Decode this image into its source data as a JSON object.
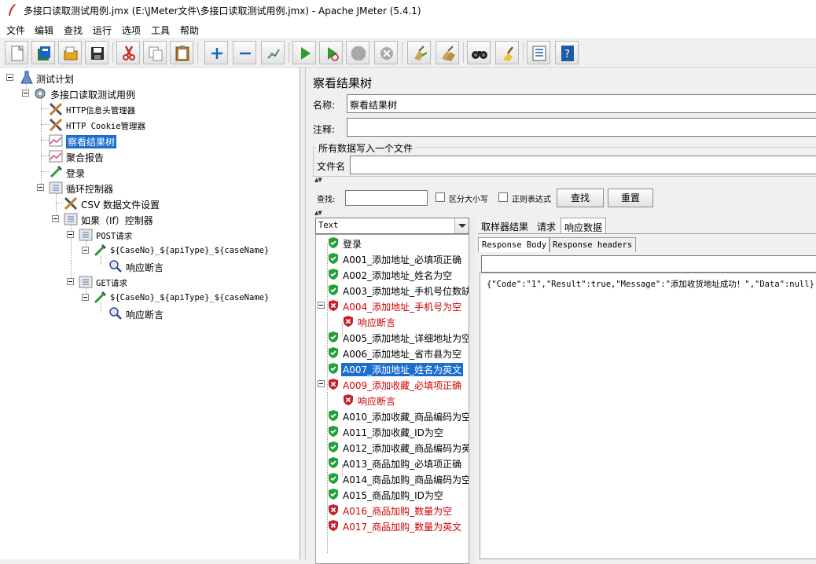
{
  "window": {
    "title": "多接口读取测试用例.jmx (E:\\JMeter文件\\多接口读取测试用例.jmx) - Apache JMeter (5.4.1)"
  },
  "menu": [
    "文件",
    "编辑",
    "查找",
    "运行",
    "选项",
    "工具",
    "帮助"
  ],
  "toolbar": {
    "icons": [
      "new-icon",
      "templates-icon",
      "open-icon",
      "save-icon",
      "cut-icon",
      "copy-icon",
      "paste-icon",
      "expand-icon",
      "collapse-icon",
      "toggle-icon",
      "start-icon",
      "start-no-pause-icon",
      "stop-icon",
      "shutdown-icon",
      "clear-icon",
      "clear-all-icon",
      "search-icon",
      "reset-search-icon",
      "function-helper-icon",
      "help-icon"
    ]
  },
  "tree": {
    "test_plan": "测试计划",
    "thread_group": "多接口读取测试用例",
    "header_manager": "HTTP信息头管理器",
    "cookie_manager": "HTTP Cookie管理器",
    "result_tree": "察看结果树",
    "aggregate_report": "聚合报告",
    "login": "登录",
    "loop_controller": "循环控制器",
    "csv_config": "CSV 数据文件设置",
    "if_controller": "如果（If）控制器",
    "post_controller": "POST请求",
    "post_sampler": "${CaseNo}_${apiType}_${caseName}",
    "post_assertion": "响应断言",
    "get_controller": "GET请求",
    "get_sampler": "${CaseNo}_${apiType}_${caseName}",
    "get_assertion": "响应断言"
  },
  "panel": {
    "title": "察看结果树",
    "name_label": "名称:",
    "name_value": "察看结果树",
    "comment_label": "注释:",
    "comment_value": "",
    "file_group_title": "所有数据写入一个文件",
    "filename_label": "文件名",
    "filename_value": ""
  },
  "search": {
    "label": "查找:",
    "value": "",
    "case_sensitive": "区分大小写",
    "regex": "正则表达式",
    "search_button": "查找",
    "reset_button": "重置"
  },
  "renderer": {
    "selected": "Text"
  },
  "results": [
    {
      "label": "登录",
      "status": "pass"
    },
    {
      "label": "A001_添加地址_必填项正确",
      "status": "pass"
    },
    {
      "label": "A002_添加地址_姓名为空",
      "status": "pass"
    },
    {
      "label": "A003_添加地址_手机号位数缺",
      "status": "pass"
    },
    {
      "label": "A004_添加地址_手机号为空",
      "status": "fail"
    },
    {
      "label": "响应断言",
      "status": "fail"
    },
    {
      "label": "A005_添加地址_详细地址为空",
      "status": "pass"
    },
    {
      "label": "A006_添加地址_省市县为空",
      "status": "pass"
    },
    {
      "label": "A007_添加地址_姓名为英文",
      "status": "pass"
    },
    {
      "label": "A009_添加收藏_必填项正确",
      "status": "fail"
    },
    {
      "label": "响应断言",
      "status": "fail"
    },
    {
      "label": "A010_添加收藏_商品编码为空",
      "status": "pass"
    },
    {
      "label": "A011_添加收藏_ID为空",
      "status": "pass"
    },
    {
      "label": "A012_添加收藏_商品编码为英",
      "status": "pass"
    },
    {
      "label": "A013_商品加购_必填项正确",
      "status": "pass"
    },
    {
      "label": "A014_商品加购_商品编码为空",
      "status": "pass"
    },
    {
      "label": "A015_商品加购_ID为空",
      "status": "pass"
    },
    {
      "label": "A016_商品加购_数量为空",
      "status": "fail"
    },
    {
      "label": "A017_商品加购_数量为英文",
      "status": "fail"
    }
  ],
  "tabs": {
    "sampler_result": "取样器结果",
    "request": "请求",
    "response_data": "响应数据"
  },
  "subtabs": {
    "response_body": "Response Body",
    "response_headers": "Response headers"
  },
  "response": {
    "search_value": "",
    "body": "{\"Code\":\"1\",\"Result\":true,\"Message\":\"添加收货地址成功！\",\"Data\":null}"
  },
  "colors": {
    "selection": "#1c6dd0",
    "fail_text": "#d00000",
    "pass_icon": "#22a03a",
    "fail_icon": "#c8202a"
  }
}
